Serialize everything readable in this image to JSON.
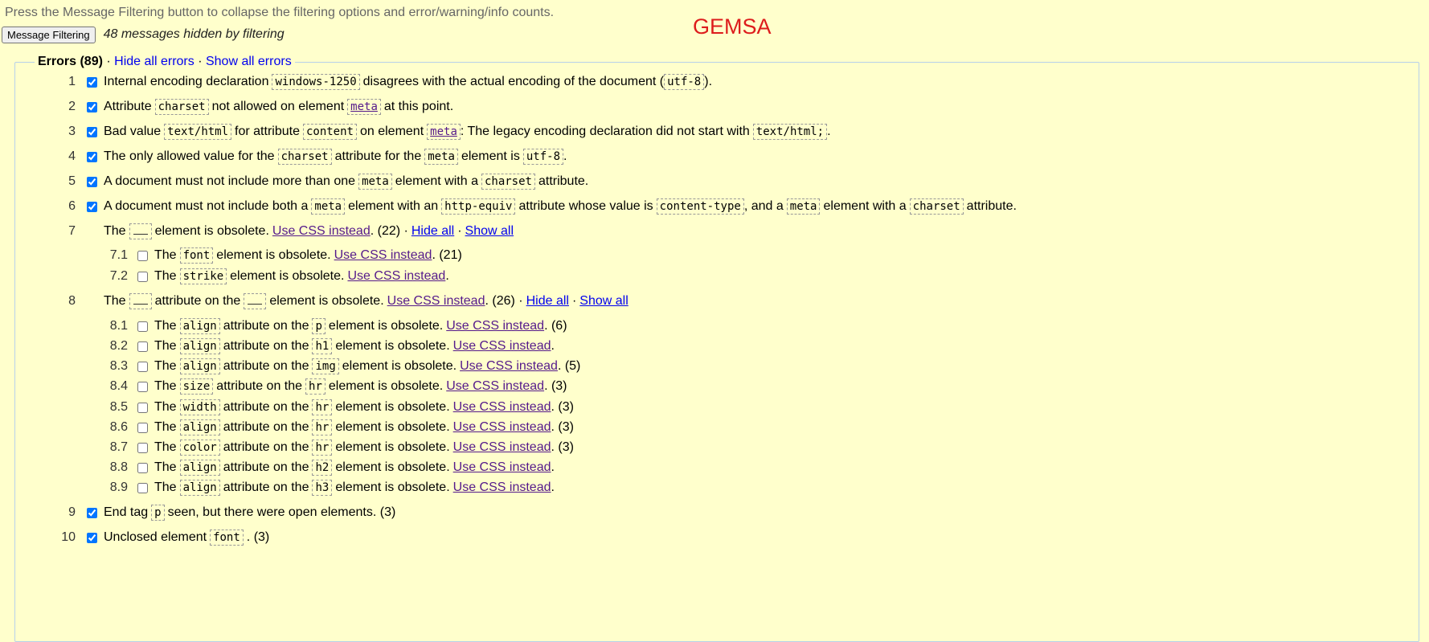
{
  "intro_text": "Press the Message Filtering button to collapse the filtering options and error/warning/info counts.",
  "filter_button": "Message Filtering",
  "hidden_count": "48 messages hidden by filtering",
  "brand": "GEMSA",
  "errors_legend": {
    "title": "Errors (89)",
    "sep": "·",
    "hide_all": "Hide all errors",
    "show_all": "Show all errors"
  },
  "common": {
    "use_css": "Use CSS instead",
    "hide_all": "Hide all",
    "show_all": "Show all",
    "dot": "·"
  },
  "messages": [
    {
      "n": "1",
      "checked": true,
      "parts": [
        "Internal encoding declaration",
        "windows-1250",
        "disagrees with the actual encoding of the document (",
        "utf-8",
        ")."
      ]
    },
    {
      "n": "2",
      "checked": true,
      "parts": [
        "Attribute",
        "charset",
        "not allowed on element",
        "meta",
        "at this point."
      ]
    },
    {
      "n": "3",
      "checked": true,
      "parts": [
        "Bad value",
        "text/html",
        "for attribute",
        "content",
        "on element",
        "meta",
        ": The legacy encoding declaration did not start with",
        "text/html;",
        "."
      ]
    },
    {
      "n": "4",
      "checked": true,
      "parts": [
        "The only allowed value for the",
        "charset",
        "attribute for the",
        "meta",
        "element is",
        "utf-8",
        "."
      ]
    },
    {
      "n": "5",
      "checked": true,
      "parts": [
        "A document must not include more than one",
        "meta",
        "element with a",
        "charset",
        "attribute."
      ]
    },
    {
      "n": "6",
      "checked": true,
      "parts": [
        "A document must not include both a",
        "meta",
        "element with an",
        "http-equiv",
        "attribute whose value is",
        "content-type",
        ", and a",
        "meta",
        "element with a",
        "charset",
        "attribute."
      ]
    },
    {
      "n": "7",
      "parts": [
        "The",
        "element is obsolete.",
        ". (22) ·"
      ]
    },
    {
      "n": "7.1",
      "checked": false,
      "parts": [
        "The",
        "font",
        "element is obsolete.",
        ". (21)"
      ]
    },
    {
      "n": "7.2",
      "checked": false,
      "parts": [
        "The",
        "strike",
        "element is obsolete.",
        "."
      ]
    },
    {
      "n": "8",
      "parts": [
        "The",
        "attribute on the",
        "element is obsolete.",
        ". (26) ·"
      ]
    },
    {
      "n": "8.1",
      "checked": false,
      "parts": [
        "The",
        "align",
        "attribute on the",
        "p",
        "element is obsolete.",
        ". (6)"
      ]
    },
    {
      "n": "8.2",
      "checked": false,
      "parts": [
        "The",
        "align",
        "attribute on the",
        "h1",
        "element is obsolete.",
        "."
      ]
    },
    {
      "n": "8.3",
      "checked": false,
      "parts": [
        "The",
        "align",
        "attribute on the",
        "img",
        "element is obsolete.",
        ". (5)"
      ]
    },
    {
      "n": "8.4",
      "checked": false,
      "parts": [
        "The",
        "size",
        "attribute on the",
        "hr",
        "element is obsolete.",
        ". (3)"
      ]
    },
    {
      "n": "8.5",
      "checked": false,
      "parts": [
        "The",
        "width",
        "attribute on the",
        "hr",
        "element is obsolete.",
        ". (3)"
      ]
    },
    {
      "n": "8.6",
      "checked": false,
      "parts": [
        "The",
        "align",
        "attribute on the",
        "hr",
        "element is obsolete.",
        ". (3)"
      ]
    },
    {
      "n": "8.7",
      "checked": false,
      "parts": [
        "The",
        "color",
        "attribute on the",
        "hr",
        "element is obsolete.",
        ". (3)"
      ]
    },
    {
      "n": "8.8",
      "checked": false,
      "parts": [
        "The",
        "align",
        "attribute on the",
        "h2",
        "element is obsolete.",
        "."
      ]
    },
    {
      "n": "8.9",
      "checked": false,
      "parts": [
        "The",
        "align",
        "attribute on the",
        "h3",
        "element is obsolete.",
        "."
      ]
    },
    {
      "n": "9",
      "checked": true,
      "parts": [
        "End tag",
        "p",
        "seen, but there were open elements. (3)"
      ]
    },
    {
      "n": "10",
      "checked": true,
      "parts": [
        "Unclosed element",
        "font",
        ". (3)"
      ]
    }
  ]
}
